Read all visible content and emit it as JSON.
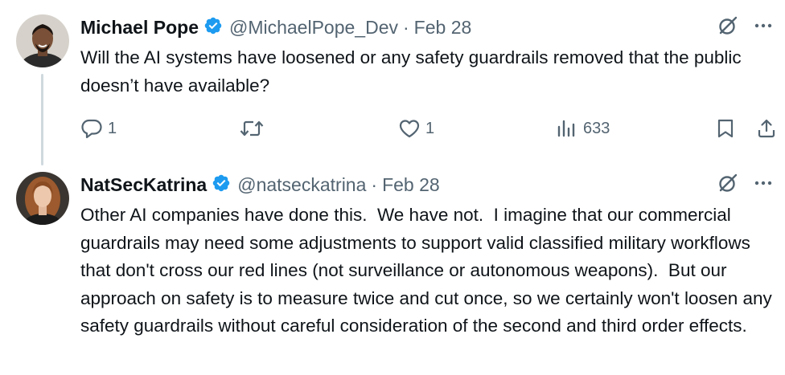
{
  "tweets": [
    {
      "author_name": "Michael Pope",
      "handle": "@MichaelPope_Dev",
      "separator": "·",
      "date": "Feb 28",
      "text": "Will the AI systems have loosened or any safety guardrails removed that the public doesn’t have available?",
      "stats": {
        "replies": "1",
        "retweets": "",
        "likes": "1",
        "views": "633"
      }
    },
    {
      "author_name": "NatSecKatrina",
      "handle": "@natseckatrina",
      "separator": "·",
      "date": "Feb 28",
      "text": "Other AI companies have done this.  We have not.  I imagine that our commercial guardrails may need some adjustments to support valid classified military workflows that don't cross our red lines (not surveillance or autonomous weapons).  But our approach on safety is to measure twice and cut once, so we certainly won't loosen any safety guardrails without careful consideration of the second and third order effects."
    }
  ],
  "colors": {
    "verified": "#1d9bf0",
    "secondary_text": "#536471",
    "primary_text": "#0f1419",
    "thread_line": "#cfd9de"
  },
  "icons": [
    "verified-badge-icon",
    "grok-icon",
    "more-icon",
    "reply-icon",
    "retweet-icon",
    "like-icon",
    "views-icon",
    "bookmark-icon",
    "share-icon"
  ]
}
